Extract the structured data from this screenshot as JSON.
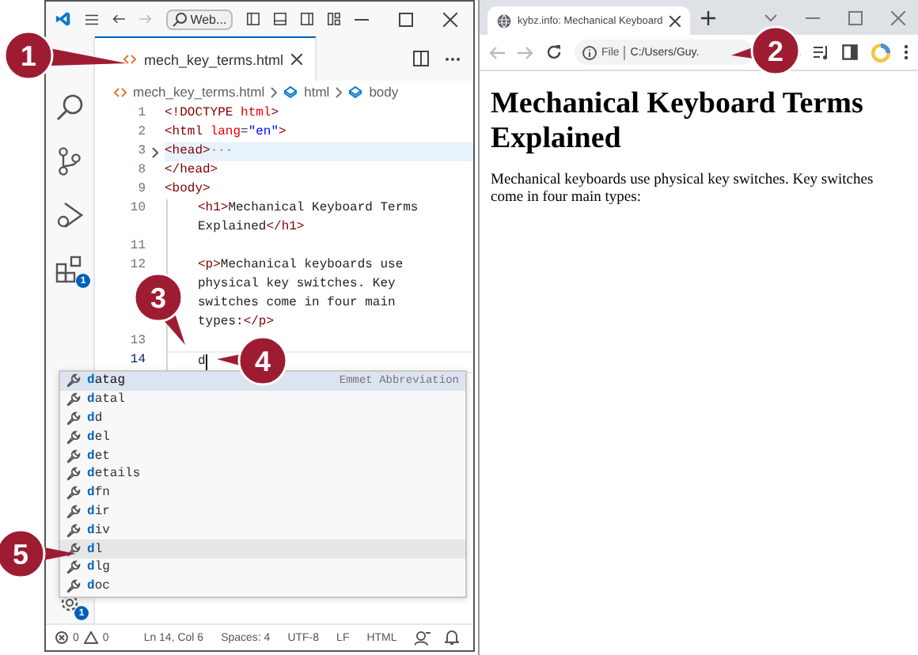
{
  "editor": {
    "search": "Web...",
    "activity_bar": [
      {
        "kind": "search"
      },
      {
        "kind": "source_control"
      },
      {
        "kind": "run_debug"
      },
      {
        "kind": "extensions",
        "badge": "1"
      }
    ],
    "manage_badge": "1",
    "tab": {
      "label": "mech_key_terms.html",
      "selected": true
    },
    "breadcrumb": [
      "mech_key_terms.html",
      "html",
      "body"
    ],
    "lines": [
      {
        "num": "1",
        "folded": false,
        "indent": false,
        "current": false,
        "rows": [
          [
            {
              "kind": "tag",
              "t": "<!DOCTYPE "
            },
            {
              "kind": "attr",
              "t": "html"
            },
            {
              "kind": "tag",
              "t": ">"
            }
          ]
        ]
      },
      {
        "num": "2",
        "folded": false,
        "indent": false,
        "current": false,
        "rows": [
          [
            {
              "kind": "tag",
              "t": "<html "
            },
            {
              "kind": "attr",
              "t": "lang"
            },
            {
              "kind": "text",
              "t": "="
            },
            {
              "kind": "str",
              "t": "\"en\""
            },
            {
              "kind": "tag",
              "t": ">"
            }
          ]
        ]
      },
      {
        "num": "3",
        "folded": true,
        "indent": false,
        "current": false,
        "rows": [
          [
            {
              "kind": "tag",
              "t": "<head>"
            },
            {
              "kind": "dim",
              "t": "···"
            }
          ]
        ]
      },
      {
        "num": "8",
        "folded": false,
        "indent": false,
        "current": false,
        "rows": [
          [
            {
              "kind": "tag",
              "t": "</head>"
            }
          ]
        ]
      },
      {
        "num": "9",
        "folded": false,
        "indent": false,
        "current": false,
        "rows": [
          [
            {
              "kind": "tag",
              "t": "<body>"
            }
          ]
        ]
      },
      {
        "num": "10",
        "folded": false,
        "indent": true,
        "current": false,
        "rows": [
          [
            {
              "kind": "tag",
              "t": "<h1>"
            },
            {
              "kind": "text",
              "t": "Mechanical Keyboard Terms"
            }
          ],
          [
            {
              "kind": "text",
              "t": "Explained"
            },
            {
              "kind": "tag",
              "t": "</h1>"
            }
          ]
        ]
      },
      {
        "num": "11",
        "folded": false,
        "indent": true,
        "current": false,
        "rows": [
          []
        ]
      },
      {
        "num": "12",
        "folded": false,
        "indent": true,
        "current": false,
        "rows": [
          [
            {
              "kind": "tag",
              "t": "<p>"
            },
            {
              "kind": "text",
              "t": "Mechanical keyboards use"
            }
          ],
          [
            {
              "kind": "text",
              "t": "physical key switches. Key"
            }
          ],
          [
            {
              "kind": "text",
              "t": "switches come in four main"
            }
          ],
          [
            {
              "kind": "text",
              "t": "types:"
            },
            {
              "kind": "tag",
              "t": "</p>"
            }
          ]
        ]
      },
      {
        "num": "13",
        "folded": false,
        "indent": true,
        "current": false,
        "rows": [
          []
        ]
      },
      {
        "num": "14",
        "folded": false,
        "indent": true,
        "current": true,
        "rows": [
          [
            {
              "kind": "text",
              "t": "d"
            }
          ]
        ]
      }
    ],
    "suggestions": [
      {
        "match": "d",
        "rest": "atag",
        "detail": "Emmet Abbreviation",
        "selected": true,
        "hovered": false
      },
      {
        "match": "d",
        "rest": "atal",
        "selected": false,
        "hovered": false
      },
      {
        "match": "d",
        "rest": "d",
        "selected": false,
        "hovered": false
      },
      {
        "match": "d",
        "rest": "el",
        "selected": false,
        "hovered": false
      },
      {
        "match": "d",
        "rest": "et",
        "selected": false,
        "hovered": false
      },
      {
        "match": "d",
        "rest": "etails",
        "selected": false,
        "hovered": false
      },
      {
        "match": "d",
        "rest": "fn",
        "selected": false,
        "hovered": false
      },
      {
        "match": "d",
        "rest": "ir",
        "selected": false,
        "hovered": false
      },
      {
        "match": "d",
        "rest": "iv",
        "selected": false,
        "hovered": false
      },
      {
        "match": "d",
        "rest": "l",
        "selected": false,
        "hovered": true
      },
      {
        "match": "d",
        "rest": "lg",
        "selected": false,
        "hovered": false
      },
      {
        "match": "d",
        "rest": "oc",
        "selected": false,
        "hovered": false
      }
    ],
    "status": {
      "errors": "0",
      "warnings": "0",
      "items": [
        "Ln 14, Col 6",
        "Spaces: 4",
        "UTF-8",
        "LF",
        "HTML"
      ]
    }
  },
  "browser": {
    "tab": {
      "title": "kybz.info: Mechanical Keyboard",
      "selected": true
    },
    "address_scheme": "File",
    "address": "C:/Users/Guy.",
    "heading": "Mechanical Keyboard Terms Explained",
    "paragraph": "Mechanical keyboards use physical key switches. Key switches come in four main types:"
  },
  "callouts": [
    {
      "number": "1"
    },
    {
      "number": "2"
    },
    {
      "number": "3"
    },
    {
      "number": "4"
    },
    {
      "number": "5"
    }
  ]
}
